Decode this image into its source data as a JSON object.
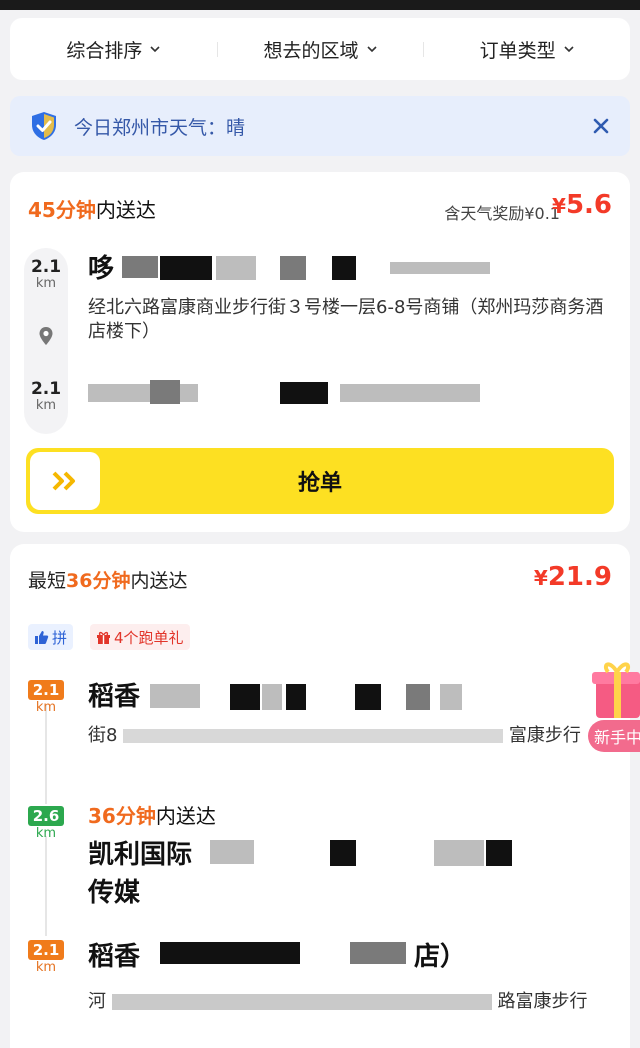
{
  "filters": [
    {
      "label": "综合排序"
    },
    {
      "label": "想去的区域"
    },
    {
      "label": "订单类型"
    }
  ],
  "weather": {
    "text": "今日郑州市天气：晴"
  },
  "order1": {
    "time_num": "45",
    "time_unit": "分钟",
    "time_suffix": "内送达",
    "bonus": "含天气奖励¥0.1",
    "price_symbol": "¥",
    "price": "5.6",
    "pickup": {
      "distance": "2.1",
      "unit": "km",
      "name": "哆",
      "address": "经北六路富康商业步行街３号楼一层6-8号商铺（郑州玛莎商务酒店楼下）"
    },
    "dropoff": {
      "distance": "2.1",
      "unit": "km"
    },
    "grab_label": "抢单"
  },
  "order2": {
    "prefix": "最短",
    "time_num": "36",
    "time_unit": "分钟",
    "time_suffix": "内送达",
    "price_symbol": "¥",
    "price": "21.9",
    "tags": [
      {
        "label": "拼"
      },
      {
        "label": "4个跑单礼"
      }
    ],
    "stops": [
      {
        "distance": "2.1",
        "unit": "km",
        "name": "稻香",
        "address": "富康步行",
        "address_line2": "街8"
      },
      {
        "distance": "2.6",
        "unit": "km",
        "eta_num": "36",
        "eta_unit": "分钟",
        "eta_suffix": "内送达",
        "name": "凯利国际",
        "name_line2": "传媒"
      },
      {
        "distance": "2.1",
        "unit": "km",
        "name": "稻香",
        "name_tail": "店）",
        "address": "河",
        "address_tail": "路富康步行"
      }
    ]
  },
  "newbie_label": "新手中",
  "colors": {
    "accent_yellow": "#fde022",
    "orange": "#f06a1e",
    "price_red": "#f33a28",
    "weather_bg": "#e7eefc",
    "link_blue": "#3558a8"
  }
}
